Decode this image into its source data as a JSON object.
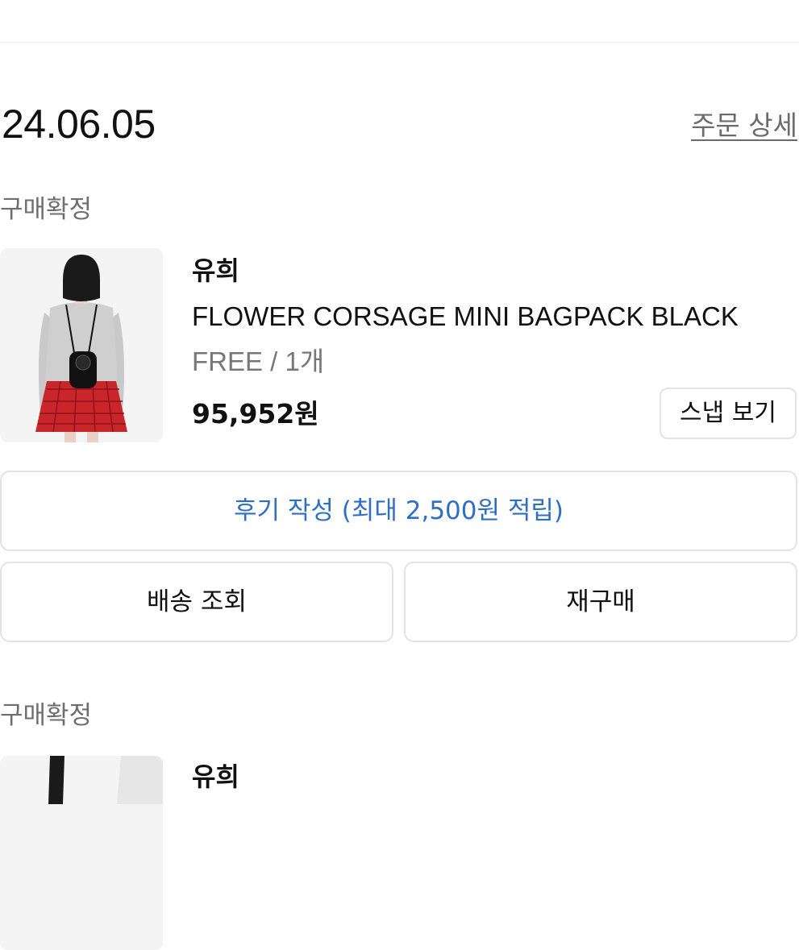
{
  "order": {
    "date": "24.06.05",
    "detail_link": "주문 상세"
  },
  "items": [
    {
      "status": "구매확정",
      "brand": "유희",
      "name": "FLOWER CORSAGE MINI BAGPACK BLACK",
      "option": "FREE / 1개",
      "price": "95,952원",
      "snap_button": "스냅 보기",
      "review_button": "후기 작성 (최대 2,500원 적립)",
      "tracking_button": "배송 조회",
      "rebuy_button": "재구매"
    },
    {
      "status": "구매확정",
      "brand": "유희"
    }
  ],
  "colors": {
    "accent_blue": "#2e6fc4",
    "muted_text": "#6e6e6e",
    "border": "#e3e3e3",
    "skirt_red": "#c9262b"
  }
}
